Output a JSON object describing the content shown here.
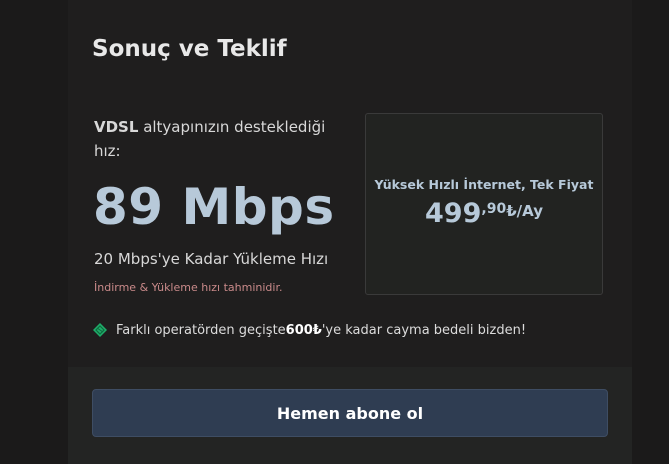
{
  "section": {
    "title": "Sonuç ve Teklif"
  },
  "result": {
    "infrastructure": "VDSL",
    "label_rest": " altyapınızın desteklediği hız:",
    "speed": "89 Mbps",
    "upload": "20 Mbps'ye Kadar Yükleme Hızı",
    "disclaimer": "İndirme & Yükleme hızı tahminidir."
  },
  "offer": {
    "title": "Yüksek Hızlı İnternet, Tek Fiyat",
    "price_whole": "499",
    "price_fraction": ",90",
    "price_unit": "₺/Ay"
  },
  "notice": {
    "icon": "diamond-icon",
    "text_before": "Farklı operatörden geçişte ",
    "amount": "600₺",
    "text_after": "'ye kadar cayma bedeli bizden!"
  },
  "cta": {
    "label": "Hemen abone ol"
  },
  "colors": {
    "accent": "#b7c9d9",
    "button_bg": "#2f3d52",
    "icon_green": "#1fae6a",
    "disclaimer": "#c98a8a"
  }
}
